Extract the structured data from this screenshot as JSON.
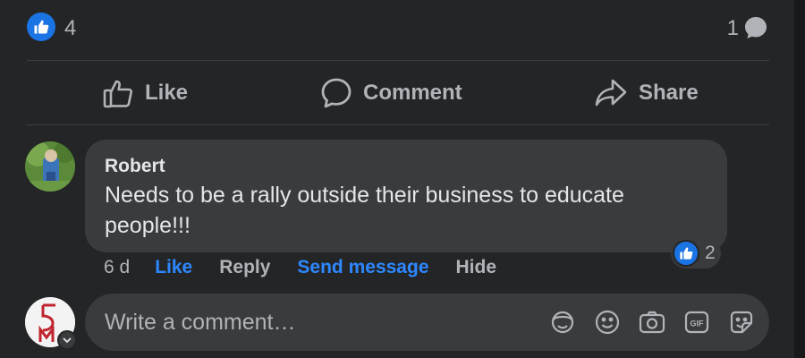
{
  "stats": {
    "reaction_count": "4",
    "comment_count": "1"
  },
  "actions": {
    "like": "Like",
    "comment": "Comment",
    "share": "Share"
  },
  "comment": {
    "author": "Robert",
    "text": "Needs to be a rally outside their business to educate people!!!",
    "reaction_count": "2",
    "time": "6 d",
    "like": "Like",
    "reply": "Reply",
    "send_message": "Send message",
    "hide": "Hide"
  },
  "composer": {
    "placeholder": "Write a comment…"
  },
  "colors": {
    "accent": "#2d88ff",
    "like_badge": "#1b74e4",
    "background": "#242526",
    "bubble": "#3a3b3c"
  }
}
